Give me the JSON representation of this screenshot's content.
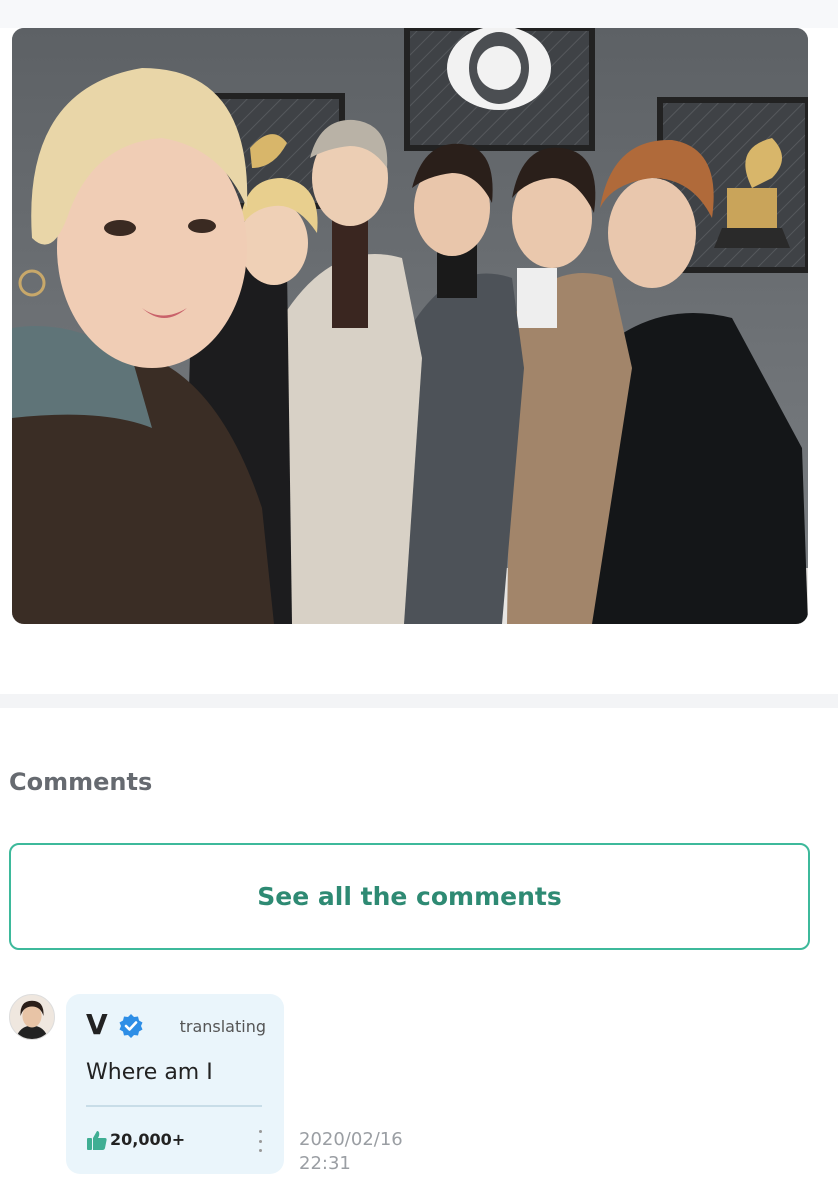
{
  "comments_section": {
    "title": "Comments",
    "see_all_label": "See all the comments"
  },
  "comment": {
    "author": "V",
    "verified_icon": "verified-badge-icon",
    "translate_label": "translating",
    "text": "Where am I",
    "like_icon": "thumbs-up-icon",
    "like_count": "20,000+",
    "more_icon": "more-vertical-icon",
    "date": "2020/02/16",
    "time": "22:31"
  },
  "colors": {
    "accent": "#3db99b",
    "accent_text": "#2e8a73",
    "bubble_bg": "#eaf5fb",
    "verified": "#2e8ee6",
    "like": "#3fae93"
  }
}
